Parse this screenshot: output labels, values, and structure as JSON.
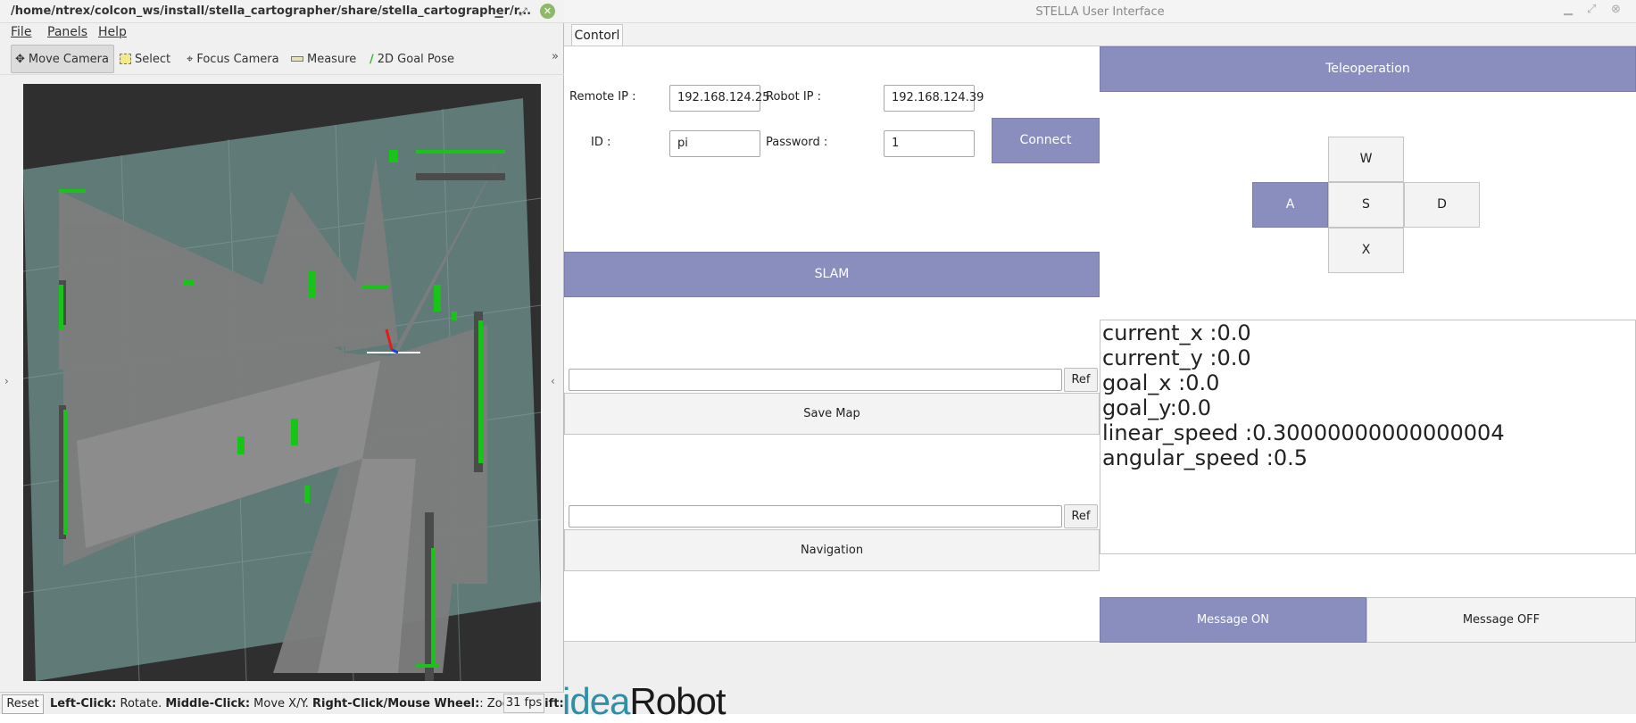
{
  "rviz": {
    "window_title": "/home/ntrex/colcon_ws/install/stella_cartographer/share/stella_cartographer/r...",
    "menu": [
      "File",
      "Panels",
      "Help"
    ],
    "tools": [
      {
        "label": "Move Camera",
        "icon": "move-camera-icon",
        "active": true
      },
      {
        "label": "Select",
        "icon": "select-icon",
        "active": false
      },
      {
        "label": "Focus Camera",
        "icon": "focus-camera-icon",
        "active": false
      },
      {
        "label": "Measure",
        "icon": "measure-icon",
        "active": false
      },
      {
        "label": "2D Goal Pose",
        "icon": "goal-pose-icon",
        "active": false
      }
    ],
    "more_glyph": "»",
    "status": {
      "reset_label": "Reset",
      "hint_parts": [
        {
          "text": "Left-Click:",
          "bold": true
        },
        {
          "text": " Rotate. ",
          "bold": false
        },
        {
          "text": "Middle-Click:",
          "bold": true
        },
        {
          "text": " Move X/Y. ",
          "bold": false
        },
        {
          "text": "Right-Click/Mouse Wheel:",
          "bold": true
        },
        {
          "text": ": Zoom. ",
          "bold": false
        },
        {
          "text": "Shift:",
          "bold": true
        }
      ],
      "fps": "31 fps"
    },
    "map_colors": {
      "background": "#2f2f2f",
      "unknown": "#5f7a77",
      "free": "#7d7d7d",
      "wall": "#4a4a4a",
      "scan": "#19c419"
    }
  },
  "stella": {
    "window_title": "STELLA User Interface",
    "tab_label": "Contorl",
    "connection": {
      "remote_ip_label": "Remote IP :",
      "remote_ip_value": "192.168.124.25",
      "robot_ip_label": "Robot IP :",
      "robot_ip_value": "192.168.124.39",
      "id_label": "ID :",
      "id_value": "pi",
      "password_label": "Password :",
      "password_value": "1",
      "connect_label": "Connect"
    },
    "slam_label": "SLAM",
    "save_map": {
      "ref_label": "Ref",
      "button_label": "Save Map",
      "path_value": ""
    },
    "navigation": {
      "ref_label": "Ref",
      "button_label": "Navigation",
      "path_value": ""
    },
    "teleop": {
      "header_label": "Teleoperation",
      "keys": {
        "w": "W",
        "a": "A",
        "s": "S",
        "d": "D",
        "x": "X"
      },
      "active_key": "A"
    },
    "status_lines": [
      "current_x :0.0",
      "current_y :0.0",
      "goal_x :0.0",
      "goal_y:0.0",
      "linear_speed :0.30000000000000004",
      "angular_speed :0.5"
    ],
    "message_on_label": "Message ON",
    "message_off_label": "Message OFF",
    "logo": {
      "part1": "idea",
      "part2": "Robot"
    },
    "accent_color": "#8a8ebe"
  }
}
